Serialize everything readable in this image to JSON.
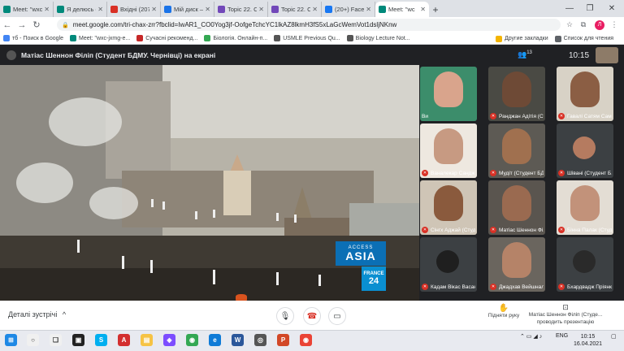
{
  "browser": {
    "tabs": [
      {
        "title": "Meet: \"wxc-jx",
        "icon": "meet-icon",
        "color": "#00897b"
      },
      {
        "title": "Я делюсь с вами",
        "icon": "meet-icon",
        "color": "#00897b"
      },
      {
        "title": "Вхідні (207) -",
        "icon": "gmail-icon",
        "color": "#d93025"
      },
      {
        "title": "Мій диск – G",
        "icon": "drive-icon",
        "color": "#1a73e8"
      },
      {
        "title": "Topic 22. Clo",
        "icon": "doc-icon",
        "color": "#7248b9"
      },
      {
        "title": "Topic 22. Clo",
        "icon": "doc-icon",
        "color": "#7248b9"
      },
      {
        "title": "(20+) Facebo",
        "icon": "facebook-icon",
        "color": "#1877f2"
      },
      {
        "title": "Meet: \"wc",
        "icon": "meet-icon",
        "color": "#00897b"
      }
    ],
    "url": "meet.google.com/tri-chax-zrr?fbclid=IwAR1_CO0Yog3jf-OofgeTchcYC1lkAZ8lkmH3fS5xLaGcWemVot1dsljNKnw",
    "bookmarks": [
      {
        "label": "тб - Поиск в Google",
        "color": "#4285f4"
      },
      {
        "label": "Meet: \"wxc-jxmg-e...",
        "color": "#00897b"
      },
      {
        "label": "Сучасні рекоменд...",
        "color": "#c62828"
      },
      {
        "label": "Біологія. Онлайн-п...",
        "color": "#34a853"
      },
      {
        "label": "USMLE Previous Qu...",
        "color": "#555555"
      },
      {
        "label": "Biology Lecture Not...",
        "color": "#555555"
      }
    ],
    "bookmarks_right": [
      {
        "label": "Другие закладки",
        "color": "#f4b400"
      },
      {
        "label": "Список для чтения",
        "color": "#5f6368"
      }
    ],
    "profile_letter": "Л"
  },
  "meet": {
    "presenter_text": "Матіас Шеннон Філіп (Студент БДМУ. Чернівці) на екрані",
    "participant_count": "13",
    "time": "10:15",
    "presentation": {
      "logo_top": "ACCESS",
      "logo_main": "ASIA",
      "badge_top": "FRANCE",
      "badge_main": "24"
    },
    "participants": [
      {
        "name": "Ви",
        "muted": false,
        "face": "#d9a48c",
        "bg": "#3c8d6b"
      },
      {
        "name": "Ранджан Адітія (Ст...",
        "muted": true,
        "face": "#6e4a36",
        "bg": "#4a4a44"
      },
      {
        "name": "Гавалі Сатям Сам...",
        "muted": true,
        "face": "#8b5e44",
        "bg": "#d8d2c6"
      },
      {
        "name": "Ваналекар Санджі...",
        "muted": true,
        "face": "#c79a82",
        "bg": "#eee8e0"
      },
      {
        "name": "Мудіт (Студент БД...",
        "muted": true,
        "face": "#a0704f",
        "bg": "#5d5a54"
      },
      {
        "name": "Шівані (Студент Б...",
        "muted": true,
        "face": "#b57b60",
        "bg": "#3c4043"
      },
      {
        "name": "Сінгх Аджай (Студ...",
        "muted": true,
        "face": "#8a5a3d",
        "bg": "#cfc5b6"
      },
      {
        "name": "Матіас Шеннон Фі...",
        "muted": true,
        "face": "#9a6a50",
        "bg": "#5a554f"
      },
      {
        "name": "Бінна Палак (Студ...",
        "muted": true,
        "face": "#c2927a",
        "bg": "#e3ddd4"
      },
      {
        "name": "Кадам Вікас Васан...",
        "muted": true,
        "face": "#1f1f1f",
        "bg": "#3c4043"
      },
      {
        "name": "Джадхав Вейшналі ...",
        "muted": true,
        "face": "#b58368",
        "bg": "#6a655e"
      },
      {
        "name": "Бхардвадж Пріянк...",
        "muted": true,
        "face": "#2a2a2a",
        "bg": "#3c4043"
      }
    ],
    "meeting_details": "Деталі зустрічі",
    "raise_hand": "Підняти руку",
    "presenting": "Матіас Шеннон Філіп (Студе...",
    "presenting_sub": "проводить презентацію"
  },
  "taskbar": {
    "lang": "ENG",
    "time": "10:15",
    "date": "16.04.2021"
  }
}
